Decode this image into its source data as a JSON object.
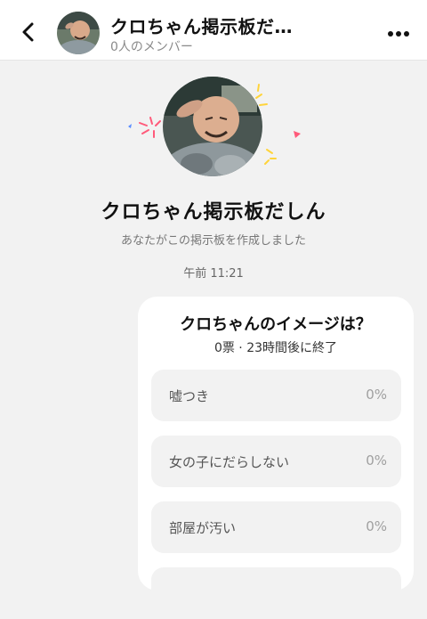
{
  "header": {
    "title": "クロちゃん掲示板だ…",
    "member_count": "0人のメンバー"
  },
  "board": {
    "name": "クロちゃん掲示板だしん",
    "created_message": "あなたがこの掲示板を作成しました"
  },
  "timestamp": "午前 11:21",
  "poll": {
    "question": "クロちゃんのイメージは？",
    "meta": "0票 · 23時間後に終了",
    "options": [
      {
        "label": "嘘つき",
        "percent": "0%",
        "fraction": 0
      },
      {
        "label": "女の子にだらしない",
        "percent": "0%",
        "fraction": 0
      },
      {
        "label": "部屋が汚い",
        "percent": "0%",
        "fraction": 0
      }
    ]
  },
  "colors": {
    "background": "#f2f2f2",
    "card": "#ffffff",
    "option_background": "#f2f2f2",
    "confetti_pink": "#ff5a7a",
    "confetti_yellow": "#ffd43b",
    "confetti_blue": "#5a8cff"
  },
  "icons": {
    "back": "chevron-left-icon",
    "more": "more-horizontal-icon"
  }
}
